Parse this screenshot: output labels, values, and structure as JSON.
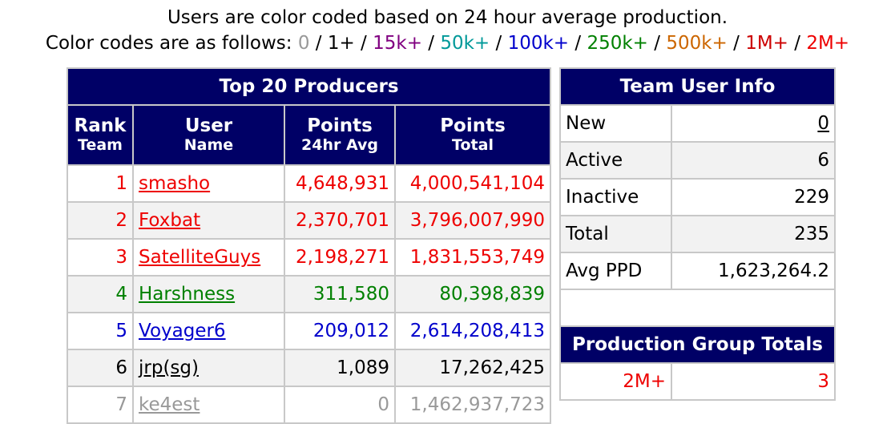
{
  "intro": {
    "line1": "Users are color coded based on 24 hour average production.",
    "line2_prefix": "Color codes are as follows: ",
    "codes": [
      {
        "label": "0",
        "color": "#999999"
      },
      {
        "label": "1+",
        "color": "#000000"
      },
      {
        "label": "15k+",
        "color": "#800080"
      },
      {
        "label": "50k+",
        "color": "#009999"
      },
      {
        "label": "100k+",
        "color": "#0000cc"
      },
      {
        "label": "250k+",
        "color": "#008000"
      },
      {
        "label": "500k+",
        "color": "#cc6600"
      },
      {
        "label": "1M+",
        "color": "#cc0000"
      },
      {
        "label": "2M+",
        "color": "#ee0000"
      }
    ],
    "separator": " / "
  },
  "top20": {
    "title": "Top 20 Producers",
    "columns": [
      {
        "main": "Rank",
        "sub": "Team"
      },
      {
        "main": "User",
        "sub": "Name"
      },
      {
        "main": "Points",
        "sub": "24hr Avg"
      },
      {
        "main": "Points",
        "sub": "Total"
      }
    ],
    "rows": [
      {
        "rank": "1",
        "name": "smasho",
        "avg": "4,648,931",
        "total": "4,000,541,104",
        "color": "#ee0000"
      },
      {
        "rank": "2",
        "name": "Foxbat",
        "avg": "2,370,701",
        "total": "3,796,007,990",
        "color": "#ee0000"
      },
      {
        "rank": "3",
        "name": "SatelliteGuys",
        "avg": "2,198,271",
        "total": "1,831,553,749",
        "color": "#ee0000"
      },
      {
        "rank": "4",
        "name": "Harshness",
        "avg": "311,580",
        "total": "80,398,839",
        "color": "#008000"
      },
      {
        "rank": "5",
        "name": "Voyager6",
        "avg": "209,012",
        "total": "2,614,208,413",
        "color": "#0000cc"
      },
      {
        "rank": "6",
        "name": "jrp(sg)",
        "avg": "1,089",
        "total": "17,262,425",
        "color": "#000000"
      },
      {
        "rank": "7",
        "name": "ke4est",
        "avg": "0",
        "total": "1,462,937,723",
        "color": "#999999"
      }
    ]
  },
  "team_info": {
    "title": "Team User Info",
    "rows": [
      {
        "label": "New",
        "value": "0",
        "link": true
      },
      {
        "label": "Active",
        "value": "6",
        "link": false
      },
      {
        "label": "Inactive",
        "value": "229",
        "link": false
      },
      {
        "label": "Total",
        "value": "235",
        "link": false
      },
      {
        "label": "Avg PPD",
        "value": "1,623,264.2",
        "link": false
      }
    ]
  },
  "prod_group": {
    "title": "Production Group Totals",
    "rows": [
      {
        "label": "2M+",
        "value": "3",
        "color": "#ee0000"
      }
    ]
  }
}
